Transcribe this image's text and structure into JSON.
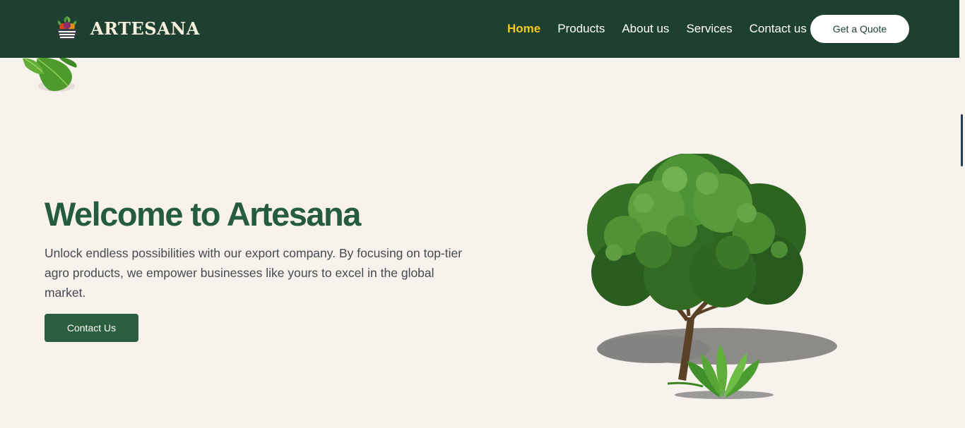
{
  "brand": {
    "name": "ARTESANA"
  },
  "nav": {
    "links": [
      {
        "label": "Home",
        "active": true
      },
      {
        "label": "Products"
      },
      {
        "label": "About us"
      },
      {
        "label": "Services"
      },
      {
        "label": "Contact us"
      }
    ],
    "cta_label": "Get a Quote"
  },
  "hero": {
    "title": "Welcome to Artesana",
    "description": "Unlock endless possibilities with our export company. By focusing on top-tier agro products, we empower businesses like yours to excel in the global market.",
    "button_label": "Contact Us"
  },
  "colors": {
    "header_bg": "#1e4030",
    "page_bg": "#f7f2ec",
    "accent_active": "#f2c81c",
    "title_green": "#255c3d",
    "button_green": "#2a5e3f"
  },
  "icons": [
    "basket-logo-icon",
    "basil-leaf-image",
    "tree-image"
  ]
}
